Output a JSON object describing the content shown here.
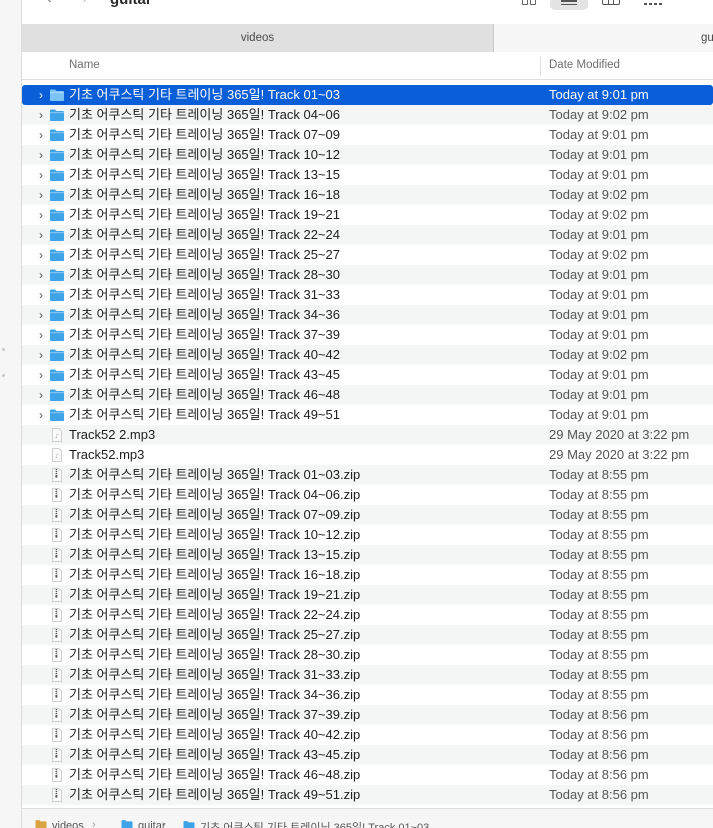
{
  "window": {
    "title": "guitar"
  },
  "tabs": [
    {
      "label": "videos"
    },
    {
      "label": "gu"
    }
  ],
  "columns": {
    "name": "Name",
    "date": "Date Modified"
  },
  "files": [
    {
      "name": "기초 어쿠스틱 기타 트레이닝 365일! Track 01~03",
      "date": "Today at 9:01 pm",
      "type": "folder",
      "selected": true
    },
    {
      "name": "기초 어쿠스틱 기타 트레이닝 365일! Track 04~06",
      "date": "Today at 9:02 pm",
      "type": "folder"
    },
    {
      "name": "기초 어쿠스틱 기타 트레이닝 365일! Track 07~09",
      "date": "Today at 9:01 pm",
      "type": "folder"
    },
    {
      "name": "기초 어쿠스틱 기타 트레이닝 365일! Track 10~12",
      "date": "Today at 9:01 pm",
      "type": "folder"
    },
    {
      "name": "기초 어쿠스틱 기타 트레이닝 365일! Track 13~15",
      "date": "Today at 9:01 pm",
      "type": "folder"
    },
    {
      "name": "기초 어쿠스틱 기타 트레이닝 365일! Track 16~18",
      "date": "Today at 9:02 pm",
      "type": "folder"
    },
    {
      "name": "기초 어쿠스틱 기타 트레이닝 365일! Track 19~21",
      "date": "Today at 9:02 pm",
      "type": "folder"
    },
    {
      "name": "기초 어쿠스틱 기타 트레이닝 365일! Track 22~24",
      "date": "Today at 9:01 pm",
      "type": "folder"
    },
    {
      "name": "기초 어쿠스틱 기타 트레이닝 365일! Track 25~27",
      "date": "Today at 9:02 pm",
      "type": "folder"
    },
    {
      "name": "기초 어쿠스틱 기타 트레이닝 365일! Track 28~30",
      "date": "Today at 9:01 pm",
      "type": "folder"
    },
    {
      "name": "기초 어쿠스틱 기타 트레이닝 365일! Track 31~33",
      "date": "Today at 9:01 pm",
      "type": "folder"
    },
    {
      "name": "기초 어쿠스틱 기타 트레이닝 365일! Track 34~36",
      "date": "Today at 9:01 pm",
      "type": "folder"
    },
    {
      "name": "기초 어쿠스틱 기타 트레이닝 365일! Track 37~39",
      "date": "Today at 9:01 pm",
      "type": "folder"
    },
    {
      "name": "기초 어쿠스틱 기타 트레이닝 365일! Track 40~42",
      "date": "Today at 9:02 pm",
      "type": "folder"
    },
    {
      "name": "기초 어쿠스틱 기타 트레이닝 365일! Track 43~45",
      "date": "Today at 9:01 pm",
      "type": "folder"
    },
    {
      "name": "기초 어쿠스틱 기타 트레이닝 365일! Track 46~48",
      "date": "Today at 9:01 pm",
      "type": "folder"
    },
    {
      "name": "기초 어쿠스틱 기타 트레이닝 365일! Track 49~51",
      "date": "Today at 9:01 pm",
      "type": "folder"
    },
    {
      "name": "Track52 2.mp3",
      "date": "29 May 2020 at 3:22 pm",
      "type": "audio"
    },
    {
      "name": "Track52.mp3",
      "date": "29 May 2020 at 3:22 pm",
      "type": "audio"
    },
    {
      "name": "기초 어쿠스틱 기타 트레이닝 365일! Track 01~03.zip",
      "date": "Today at 8:55 pm",
      "type": "zip"
    },
    {
      "name": "기초 어쿠스틱 기타 트레이닝 365일! Track 04~06.zip",
      "date": "Today at 8:55 pm",
      "type": "zip"
    },
    {
      "name": "기초 어쿠스틱 기타 트레이닝 365일! Track 07~09.zip",
      "date": "Today at 8:55 pm",
      "type": "zip"
    },
    {
      "name": "기초 어쿠스틱 기타 트레이닝 365일! Track 10~12.zip",
      "date": "Today at 8:55 pm",
      "type": "zip"
    },
    {
      "name": "기초 어쿠스틱 기타 트레이닝 365일! Track 13~15.zip",
      "date": "Today at 8:55 pm",
      "type": "zip"
    },
    {
      "name": "기초 어쿠스틱 기타 트레이닝 365일! Track 16~18.zip",
      "date": "Today at 8:55 pm",
      "type": "zip"
    },
    {
      "name": "기초 어쿠스틱 기타 트레이닝 365일! Track 19~21.zip",
      "date": "Today at 8:55 pm",
      "type": "zip"
    },
    {
      "name": "기초 어쿠스틱 기타 트레이닝 365일! Track 22~24.zip",
      "date": "Today at 8:55 pm",
      "type": "zip"
    },
    {
      "name": "기초 어쿠스틱 기타 트레이닝 365일! Track 25~27.zip",
      "date": "Today at 8:55 pm",
      "type": "zip"
    },
    {
      "name": "기초 어쿠스틱 기타 트레이닝 365일! Track 28~30.zip",
      "date": "Today at 8:55 pm",
      "type": "zip"
    },
    {
      "name": "기초 어쿠스틱 기타 트레이닝 365일! Track 31~33.zip",
      "date": "Today at 8:55 pm",
      "type": "zip"
    },
    {
      "name": "기초 어쿠스틱 기타 트레이닝 365일! Track 34~36.zip",
      "date": "Today at 8:55 pm",
      "type": "zip"
    },
    {
      "name": "기초 어쿠스틱 기타 트레이닝 365일! Track 37~39.zip",
      "date": "Today at 8:56 pm",
      "type": "zip"
    },
    {
      "name": "기초 어쿠스틱 기타 트레이닝 365일! Track 40~42.zip",
      "date": "Today at 8:56 pm",
      "type": "zip"
    },
    {
      "name": "기초 어쿠스틱 기타 트레이닝 365일! Track 43~45.zip",
      "date": "Today at 8:56 pm",
      "type": "zip"
    },
    {
      "name": "기초 어쿠스틱 기타 트레이닝 365일! Track 46~48.zip",
      "date": "Today at 8:56 pm",
      "type": "zip"
    },
    {
      "name": "기초 어쿠스틱 기타 트레이닝 365일! Track 49~51.zip",
      "date": "Today at 8:56 pm",
      "type": "zip"
    }
  ],
  "pathbar": {
    "crumbs": [
      "videos",
      "guitar",
      "기초 어쿠스틱 기타 트레이닝 365일! Track 01~03"
    ],
    "separator": "›"
  },
  "colors": {
    "selection": "#0a5ed7",
    "folder": "#3fa3e8",
    "alt_row": "#f4f5f5"
  }
}
